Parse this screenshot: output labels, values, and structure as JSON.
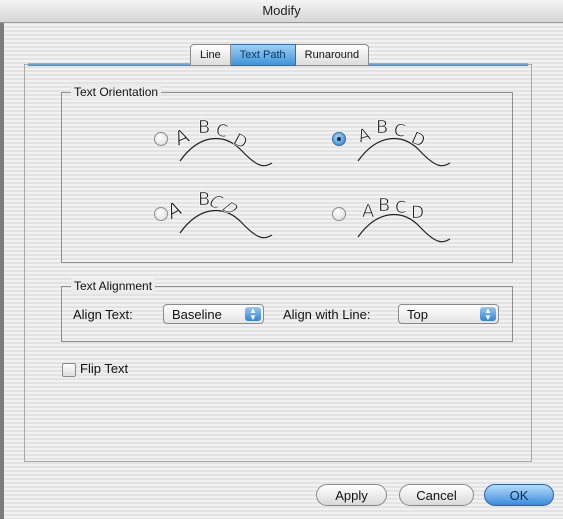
{
  "window": {
    "title": "Modify"
  },
  "tabs": [
    {
      "label": "Line",
      "active": false
    },
    {
      "label": "Text Path",
      "active": true
    },
    {
      "label": "Runaround",
      "active": false
    }
  ],
  "text_orientation": {
    "title": "Text Orientation",
    "options": [
      {
        "sample": "ABCD",
        "selected": false
      },
      {
        "sample": "ABCD",
        "selected": true
      },
      {
        "sample": "ABCD",
        "selected": false
      },
      {
        "sample": "ABCD",
        "selected": false
      }
    ]
  },
  "text_alignment": {
    "title": "Text Alignment",
    "align_text_label": "Align Text:",
    "align_text_value": "Baseline",
    "align_line_label": "Align with Line:",
    "align_line_value": "Top"
  },
  "flip_text": {
    "label": "Flip Text",
    "checked": false
  },
  "buttons": {
    "apply": "Apply",
    "cancel": "Cancel",
    "ok": "OK"
  },
  "colors": {
    "accent": "#3b8fd6",
    "background": "#ececec"
  }
}
